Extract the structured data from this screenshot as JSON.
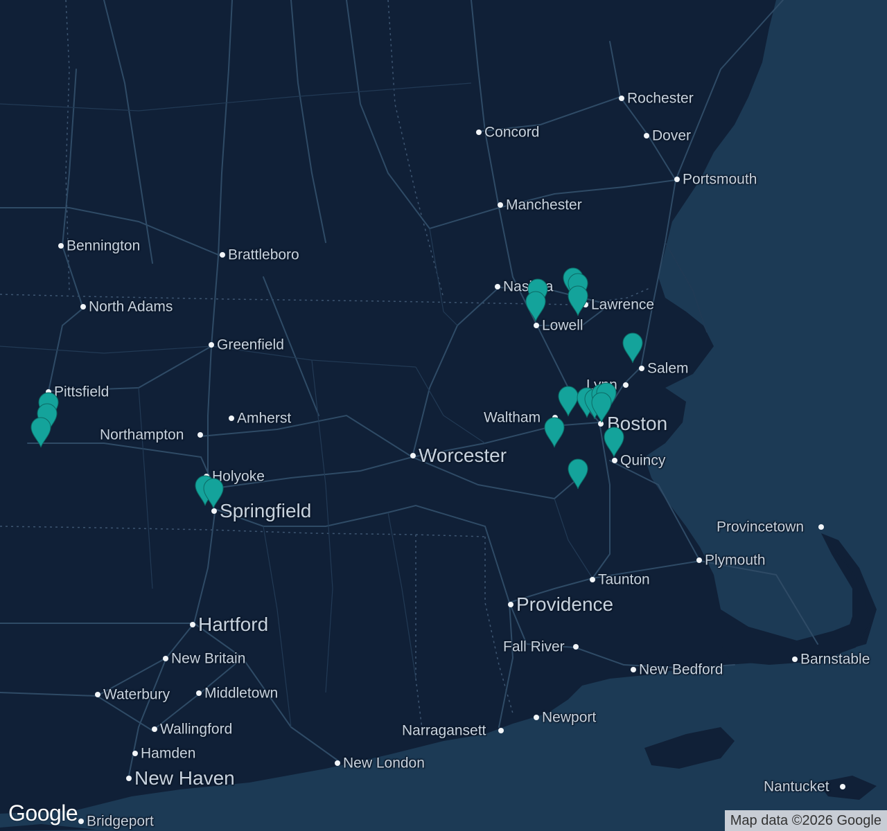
{
  "map": {
    "attribution": "Map data ©2026 Google",
    "logo": "Google",
    "colors": {
      "land": "#102037",
      "water": "#1c3a55",
      "road": "#2f4b66",
      "marker": "#14a39b",
      "label": "#c8d3df"
    },
    "cities": [
      {
        "id": "rochester",
        "name": "Rochester",
        "size": "small"
      },
      {
        "id": "concord",
        "name": "Concord",
        "size": "small"
      },
      {
        "id": "dover",
        "name": "Dover",
        "size": "small"
      },
      {
        "id": "portsmouth",
        "name": "Portsmouth",
        "size": "small"
      },
      {
        "id": "manchester",
        "name": "Manchester",
        "size": "small"
      },
      {
        "id": "bennington",
        "name": "Bennington",
        "size": "small"
      },
      {
        "id": "brattleboro",
        "name": "Brattleboro",
        "size": "small"
      },
      {
        "id": "nashua",
        "name": "Nashua",
        "size": "small"
      },
      {
        "id": "lawrence",
        "name": "Lawrence",
        "size": "small"
      },
      {
        "id": "north-adams",
        "name": "North Adams",
        "size": "small"
      },
      {
        "id": "lowell",
        "name": "Lowell",
        "size": "small"
      },
      {
        "id": "greenfield",
        "name": "Greenfield",
        "size": "small"
      },
      {
        "id": "salem",
        "name": "Salem",
        "size": "small"
      },
      {
        "id": "lynn",
        "name": "Lynn",
        "size": "small"
      },
      {
        "id": "pittsfield",
        "name": "Pittsfield",
        "size": "small"
      },
      {
        "id": "amherst",
        "name": "Amherst",
        "size": "small"
      },
      {
        "id": "waltham",
        "name": "Waltham",
        "size": "small"
      },
      {
        "id": "boston",
        "name": "Boston",
        "size": "big"
      },
      {
        "id": "northampton",
        "name": "Northampton",
        "size": "small"
      },
      {
        "id": "worcester",
        "name": "Worcester",
        "size": "big"
      },
      {
        "id": "quincy",
        "name": "Quincy",
        "size": "small"
      },
      {
        "id": "holyoke",
        "name": "Holyoke",
        "size": "small"
      },
      {
        "id": "springfield",
        "name": "Springfield",
        "size": "big"
      },
      {
        "id": "provincetown",
        "name": "Provincetown",
        "size": "small"
      },
      {
        "id": "plymouth",
        "name": "Plymouth",
        "size": "small"
      },
      {
        "id": "taunton",
        "name": "Taunton",
        "size": "small"
      },
      {
        "id": "providence",
        "name": "Providence",
        "size": "big"
      },
      {
        "id": "hartford",
        "name": "Hartford",
        "size": "big"
      },
      {
        "id": "fall-river",
        "name": "Fall River",
        "size": "small"
      },
      {
        "id": "new-britain",
        "name": "New Britain",
        "size": "small"
      },
      {
        "id": "barnstable",
        "name": "Barnstable",
        "size": "small"
      },
      {
        "id": "new-bedford",
        "name": "New Bedford",
        "size": "small"
      },
      {
        "id": "waterbury",
        "name": "Waterbury",
        "size": "small"
      },
      {
        "id": "middletown",
        "name": "Middletown",
        "size": "small"
      },
      {
        "id": "newport",
        "name": "Newport",
        "size": "small"
      },
      {
        "id": "wallingford",
        "name": "Wallingford",
        "size": "small"
      },
      {
        "id": "narragansett",
        "name": "Narragansett",
        "size": "small"
      },
      {
        "id": "hamden",
        "name": "Hamden",
        "size": "small"
      },
      {
        "id": "new-london",
        "name": "New London",
        "size": "small"
      },
      {
        "id": "new-haven",
        "name": "New Haven",
        "size": "big"
      },
      {
        "id": "nantucket",
        "name": "Nantucket",
        "size": "small"
      },
      {
        "id": "bridgeport",
        "name": "Bridgeport",
        "size": "small"
      }
    ],
    "marker_icon": "map-pin-icon",
    "marker_count": 20
  }
}
